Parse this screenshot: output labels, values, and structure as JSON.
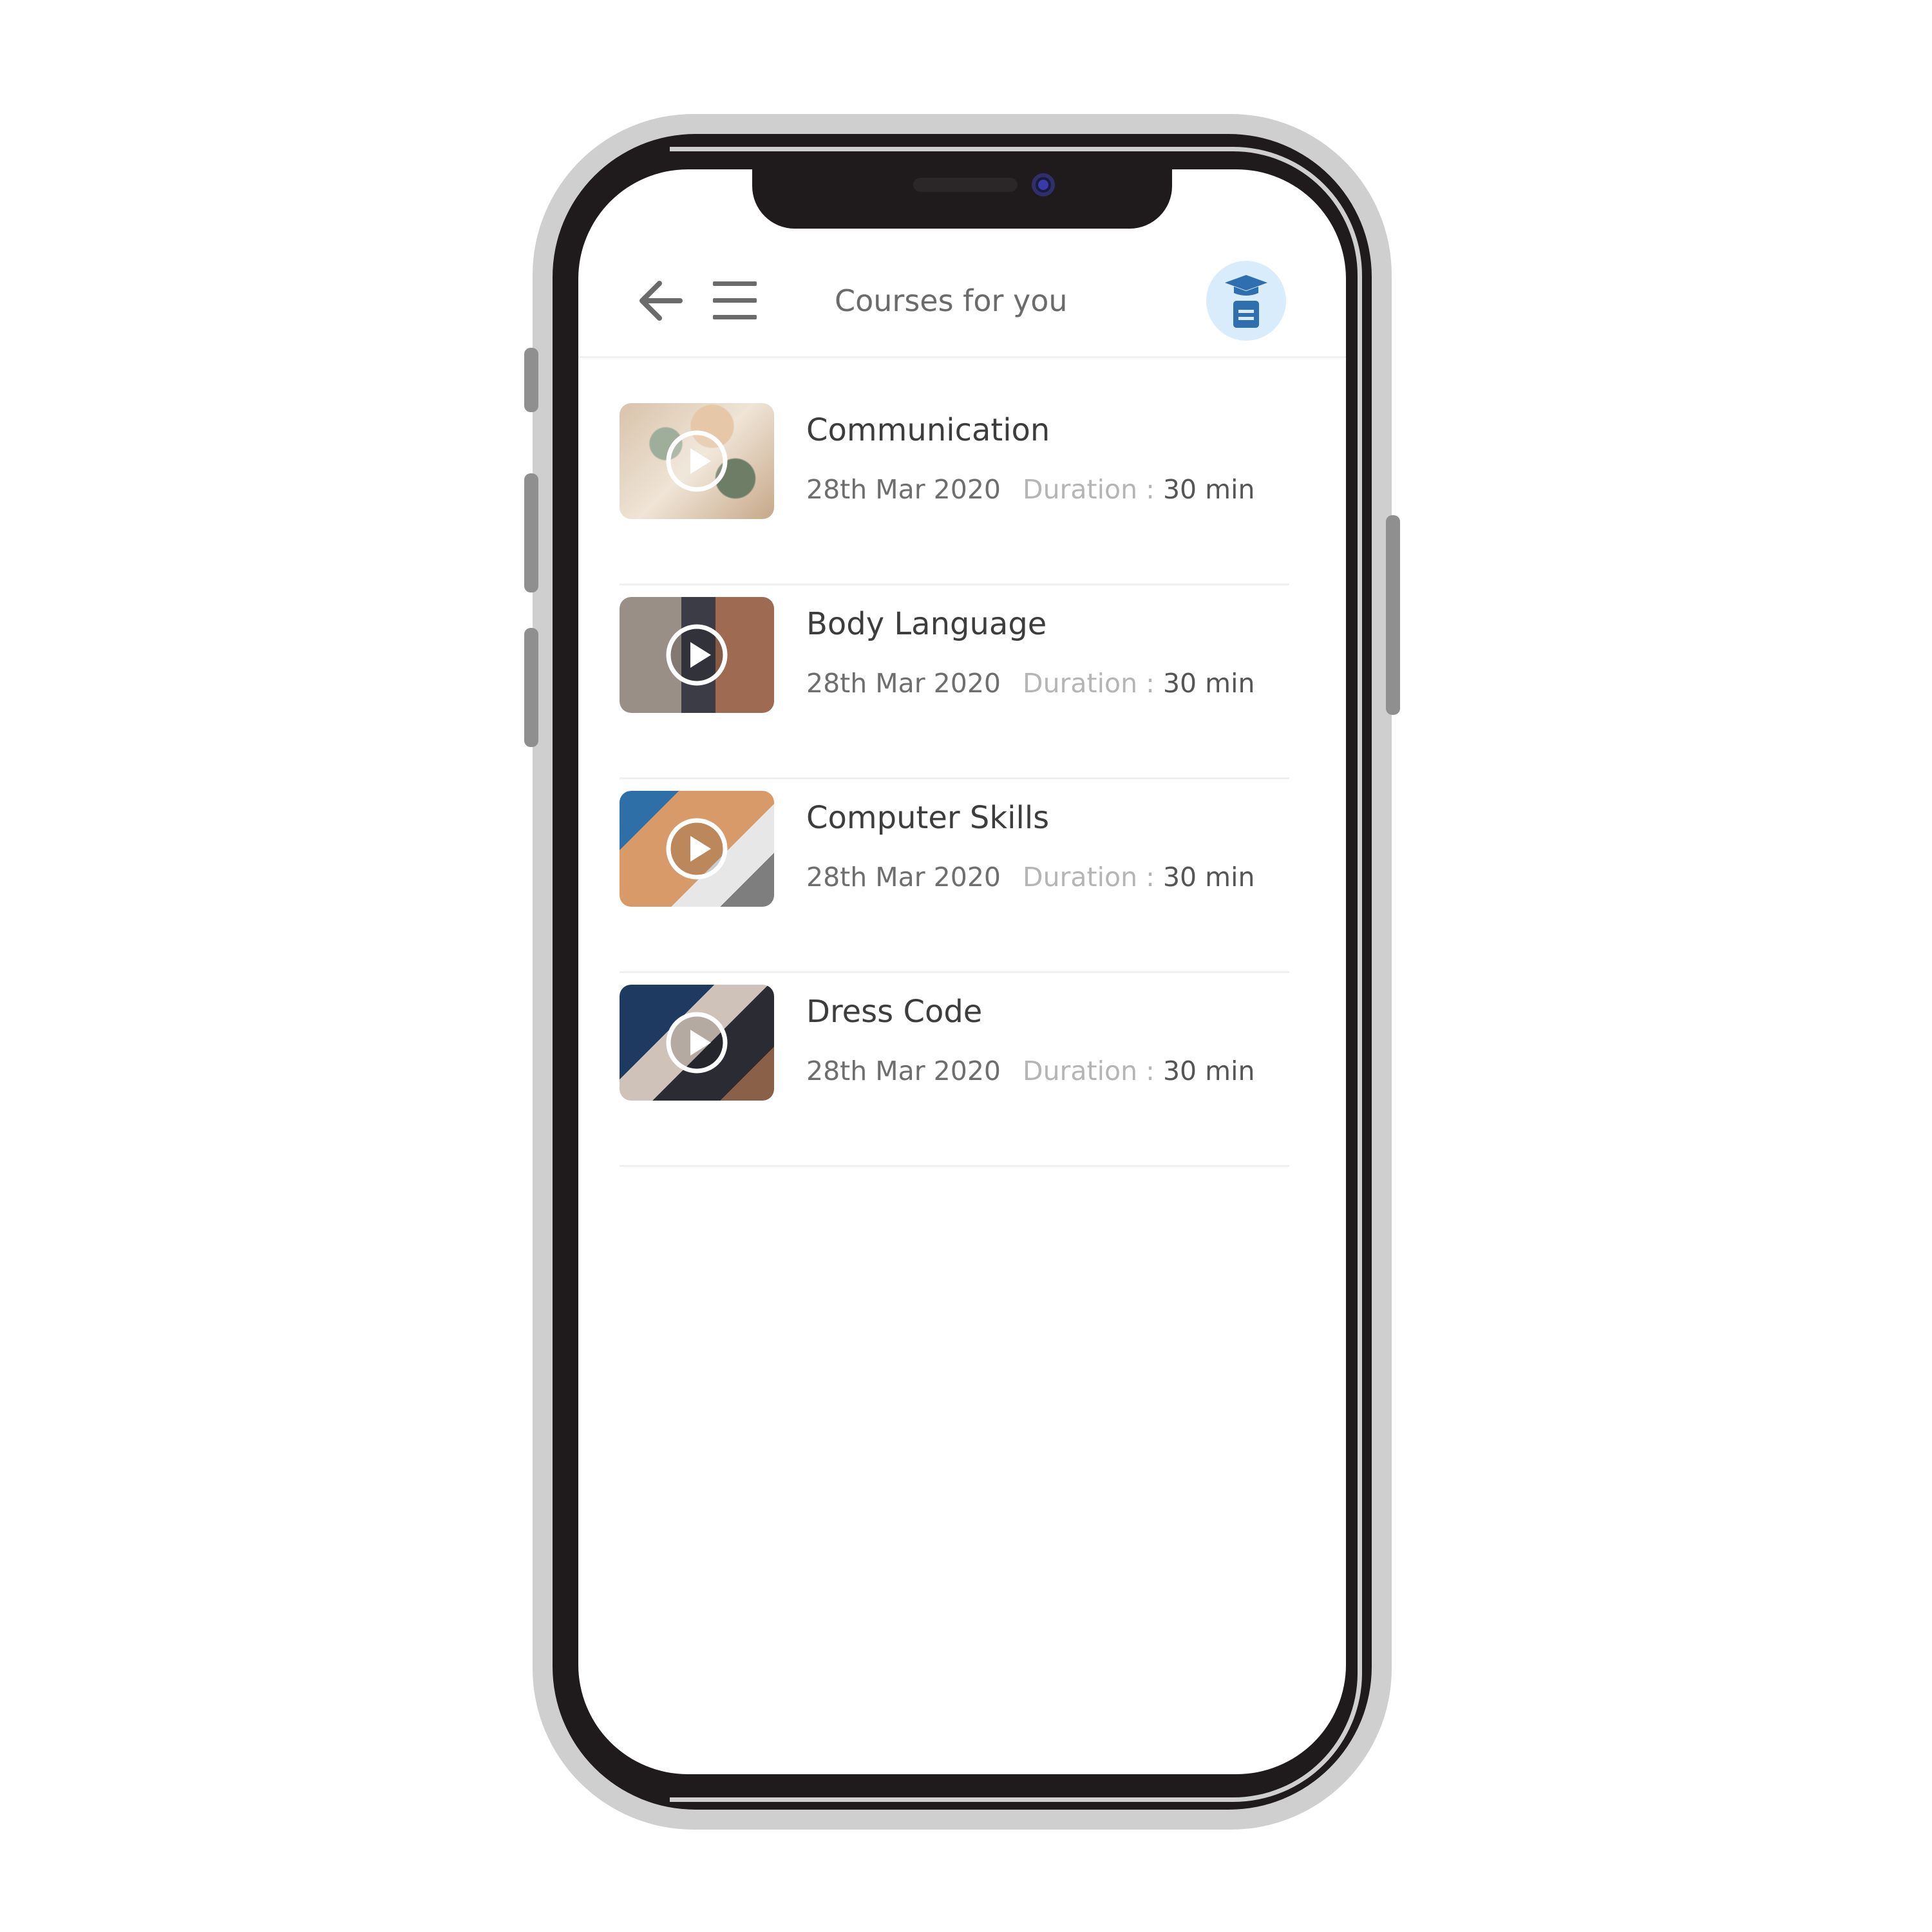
{
  "header": {
    "title": "Courses for you",
    "back_icon": "arrow-left-icon",
    "menu_icon": "hamburger-menu-icon",
    "profile_icon": "graduation-book-icon"
  },
  "courses": [
    {
      "title": "Communication",
      "date": "28th Mar 2020",
      "duration_label": "Duration :",
      "duration_value": "30 min"
    },
    {
      "title": "Body Language",
      "date": "28th Mar 2020",
      "duration_label": "Duration :",
      "duration_value": "30 min"
    },
    {
      "title": "Computer Skills",
      "date": "28th Mar 2020",
      "duration_label": "Duration :",
      "duration_value": "30 min"
    },
    {
      "title": "Dress Code",
      "date": "28th Mar 2020",
      "duration_label": "Duration :",
      "duration_value": "30 min"
    }
  ],
  "colors": {
    "accent": "#d9ecfb",
    "icon_blue": "#2f6fb0",
    "title_text": "#3d3d3d",
    "muted_text": "#b5b5b5"
  }
}
